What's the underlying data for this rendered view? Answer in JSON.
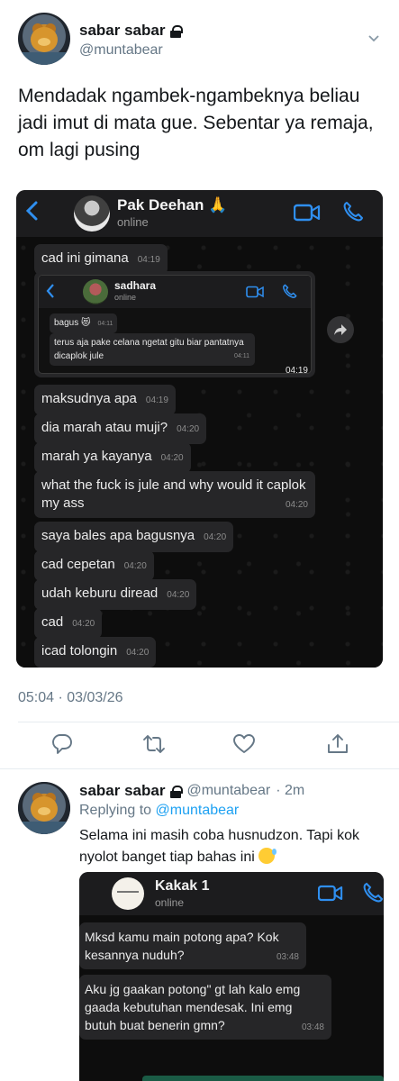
{
  "tweet": {
    "name": "sabar sabar",
    "handle": "@muntabear",
    "text": "Mendadak ngambek-ngambeknya beliau jadi imut di mata gue. Sebentar ya remaja, om lagi pusing",
    "timestamp": "05:04 · 03/03/26"
  },
  "chat1": {
    "contact": "Pak Deehan 🙏",
    "status": "online",
    "messages": [
      {
        "text": "cad ini gimana",
        "time": "04:19"
      },
      {
        "text": "maksudnya apa",
        "time": "04:19"
      },
      {
        "text": "dia marah atau muji?",
        "time": "04:20"
      },
      {
        "text": "marah ya kayanya",
        "time": "04:20"
      },
      {
        "text": "what the fuck is jule and why would it caplok my ass",
        "time": "04:20"
      },
      {
        "text": "saya bales apa bagusnya",
        "time": "04:20"
      },
      {
        "text": "cad cepetan",
        "time": "04:20"
      },
      {
        "text": "udah keburu diread",
        "time": "04:20"
      },
      {
        "text": "cad",
        "time": "04:20"
      },
      {
        "text": "icad tolongin",
        "time": "04:20"
      }
    ],
    "nested": {
      "contact": "sadhara",
      "status": "online",
      "msg1": "bagus 😻",
      "msg1_time": "04:11",
      "msg2": "terus aja pake celana ngetat gitu biar pantatnya dicaplok jule",
      "msg2_time": "04:11",
      "bubble_time": "04:19"
    }
  },
  "reply": {
    "name": "sabar sabar",
    "handle": "@muntabear",
    "ago": "· 2m",
    "replying_prefix": "Replying to",
    "replying_to": "@muntabear",
    "text": "Selama ini masih coba husnudzon. Tapi kok nyolot banget tiap bahas ini"
  },
  "chat2": {
    "contact": "Kakak 1",
    "status": "online",
    "messages": [
      {
        "text": "Mksd kamu main potong apa? Kok kesannya nuduh?",
        "time": "03:48"
      },
      {
        "text": "Aku jg gaakan potong\" gt lah kalo emg gaada kebutuhan mendesak. Ini emg butuh buat benerin gmn?",
        "time": "03:48"
      }
    ]
  },
  "colors": {
    "accent": "#1da1f2",
    "wa_blue": "#2f8ff0",
    "wa_bubble": "#262628"
  }
}
